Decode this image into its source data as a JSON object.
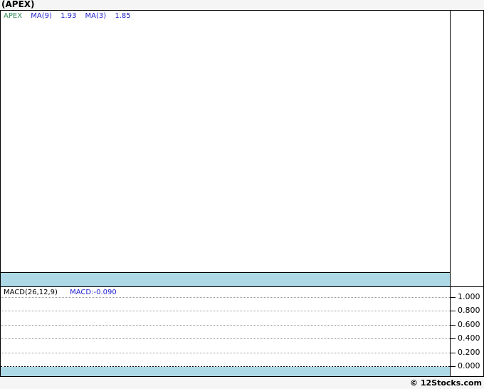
{
  "page": {
    "title": "(APEX)",
    "attribution": "© 12Stocks.com"
  },
  "price_panel": {
    "legend": {
      "symbol": "APEX",
      "ma9_label": "MA(9)",
      "ma9_value": "1.93",
      "ma3_label": "MA(3)",
      "ma3_value": "1.85"
    }
  },
  "macd_panel": {
    "legend": {
      "label": "MACD(26,12,9)",
      "value_label": "MACD:-0.090"
    },
    "axis_ticks": [
      "1.000",
      "0.800",
      "0.600",
      "0.400",
      "0.200",
      "0.000"
    ]
  },
  "colors": {
    "band": "#ADD8E6",
    "symbol_green": "#2E8B57",
    "legend_blue": "#2222CC",
    "border": "#000000",
    "grid": "#999999"
  },
  "chart_data": {
    "type": "line",
    "title": "(APEX)",
    "panels": [
      {
        "name": "price",
        "legend": [
          "APEX",
          "MA(9) 1.93",
          "MA(3) 1.85"
        ],
        "series": [
          {
            "name": "APEX",
            "color": "#2E8B57",
            "values": []
          },
          {
            "name": "MA(9)",
            "last_value": 1.93,
            "values": []
          },
          {
            "name": "MA(3)",
            "last_value": 1.85,
            "values": []
          }
        ],
        "note": "panel plot area is blank; only a flat light-blue band along the bottom edge is visible",
        "grid": false
      },
      {
        "name": "MACD(26,12,9)",
        "last_value": -0.09,
        "yticks": [
          1.0,
          0.8,
          0.6,
          0.4,
          0.2,
          0.0
        ],
        "ylim_estimate": [
          -0.15,
          1.1
        ],
        "grid": "dotted horizontal lines at each ytick, solid-dotted black zero line",
        "note": "flat light-blue band below the 0.000 line across full panel width"
      }
    ],
    "legend_position": "top-left inside each panel",
    "x_axis_labels": [],
    "source_watermark": "© 12Stocks.com"
  }
}
